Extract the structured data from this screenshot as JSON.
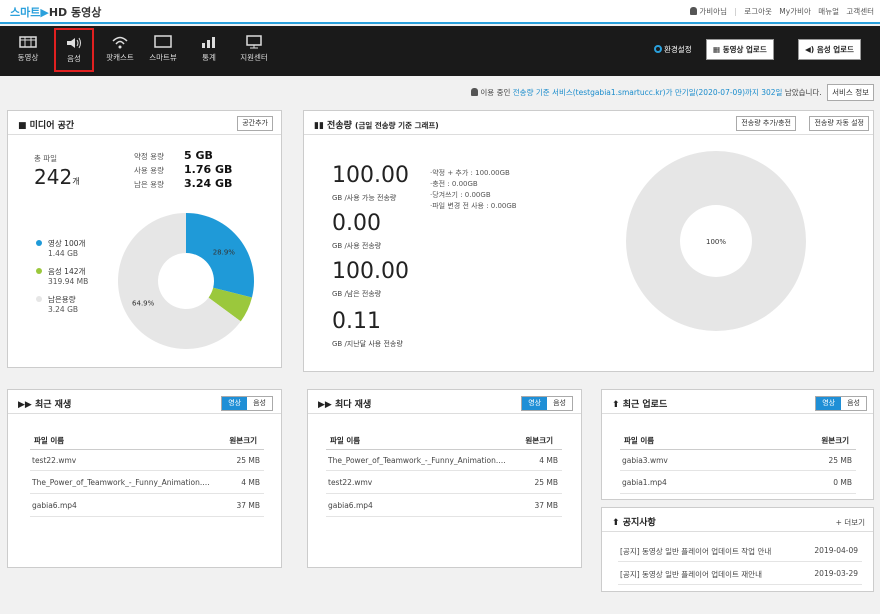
{
  "colors": {
    "accent": "#2aa0dc",
    "video": "#1f9ad8",
    "audio": "#9bc83c",
    "remain": "#e6e6e6",
    "active_border": "#e02020"
  },
  "header": {
    "logo_smart": "스마트",
    "logo_rest": "HD 동영상",
    "user": "가비아님",
    "links": [
      "로그아웃",
      "My가비아",
      "매뉴얼",
      "고객센터"
    ]
  },
  "nav": {
    "items": [
      {
        "label": "동영상",
        "icon": "film-icon"
      },
      {
        "label": "음성",
        "icon": "speaker-icon"
      },
      {
        "label": "팟캐스트",
        "icon": "wifi-icon"
      },
      {
        "label": "스마트뷰",
        "icon": "monitor-icon"
      },
      {
        "label": "통계",
        "icon": "chart-icon"
      },
      {
        "label": "지원센터",
        "icon": "support-icon"
      }
    ],
    "settings": "환경설정",
    "video_upload": "동영상 업로드",
    "audio_upload": "음성 업로드"
  },
  "service": {
    "prefix": "이용 중인",
    "product": "전송량 기준 서비스(testgabia1.smartucc.kr)",
    "expiry": "가 만기일(2020-07-09)까지 302일",
    "suffix": "남았습니다.",
    "button": "서비스 정보"
  },
  "media": {
    "title": "미디어 공간",
    "add_button": "공간추가",
    "total_label": "총 파일",
    "total_value": "242",
    "total_unit": "개",
    "contract_label": "약정 용량",
    "contract_value": "5 GB",
    "used_label": "사용 용량",
    "used_value": "1.76 GB",
    "remain_label": "남은 용량",
    "remain_value": "3.24 GB",
    "legend": [
      {
        "name": "영상 100개",
        "size": "1.44 GB"
      },
      {
        "name": "음성 142개",
        "size": "319.94 MB"
      },
      {
        "name": "남은용량",
        "size": "3.24 GB"
      }
    ]
  },
  "chart_data": [
    {
      "type": "pie",
      "categories": [
        "영상",
        "음성",
        "남은용량"
      ],
      "values": [
        28.9,
        6.2,
        64.9
      ],
      "data_labels": [
        "28.9%",
        "",
        "64.9%"
      ],
      "colors": [
        "#1f9ad8",
        "#9bc83c",
        "#e6e6e6"
      ]
    },
    {
      "type": "pie",
      "categories": [
        ""
      ],
      "values": [
        100
      ],
      "data_labels": [
        "100%"
      ],
      "colors": [
        "#e6e6e6"
      ]
    }
  ],
  "transfer": {
    "title": "전송량",
    "subtitle": "(금일 전송량 기준 그래프)",
    "btn_add": "전송량 추가/충전",
    "btn_auto": "전송량 자동 설정",
    "stats": [
      {
        "value": "100.00",
        "label": "GB /사용 가능 전송량"
      },
      {
        "value": "0.00",
        "label": "GB /사용 전송량"
      },
      {
        "value": "100.00",
        "label": "GB /남은 전송량"
      },
      {
        "value": "0.11",
        "label": "GB /지난달 사용 전송량"
      }
    ],
    "details": [
      "약정 + 추가 : 100.00GB",
      "충전 : 0.00GB",
      "당겨쓰기 : 0.00GB",
      "파일 변경 전 사용 : 0.00GB"
    ]
  },
  "recent_play": {
    "title": "최근 재생",
    "tab_video": "영상",
    "tab_audio": "음성",
    "col_name": "파일 이름",
    "col_size": "원본크기",
    "rows": [
      {
        "name": "test22.wmv",
        "size": "25 MB"
      },
      {
        "name": "The_Power_of_Teamwork_-_Funny_Animation.mp4",
        "size": "4 MB"
      },
      {
        "name": "gabia6.mp4",
        "size": "37 MB"
      }
    ]
  },
  "most_play": {
    "title": "최다 재생",
    "tab_video": "영상",
    "tab_audio": "음성",
    "col_name": "파일 이름",
    "col_size": "원본크기",
    "rows": [
      {
        "name": "The_Power_of_Teamwork_-_Funny_Animation.mp4",
        "size": "4 MB"
      },
      {
        "name": "test22.wmv",
        "size": "25 MB"
      },
      {
        "name": "gabia6.mp4",
        "size": "37 MB"
      }
    ]
  },
  "recent_upload": {
    "title": "최근 업로드",
    "tab_video": "영상",
    "tab_audio": "음성",
    "col_name": "파일 이름",
    "col_size": "원본크기",
    "rows": [
      {
        "name": "gabia3.wmv",
        "size": "25 MB"
      },
      {
        "name": "gabia1.mp4",
        "size": "0 MB"
      }
    ]
  },
  "notice": {
    "title": "공지사항",
    "more": "+ 더보기",
    "rows": [
      {
        "name": "[공지] 동영상 일반 플레이어 업데이트 작업 안내",
        "date": "2019-04-09"
      },
      {
        "name": "[공지] 동영상 일반 플레이어 업데이트 재안내",
        "date": "2019-03-29"
      }
    ]
  }
}
